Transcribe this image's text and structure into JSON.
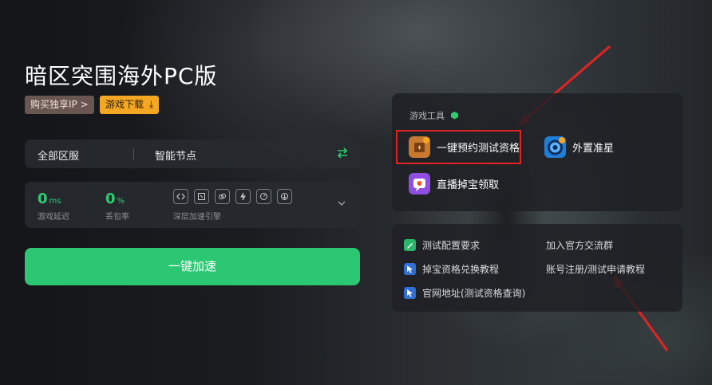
{
  "game": {
    "title": "暗区突围海外PC版",
    "buy_ip_label": "购买独享IP >",
    "download_label": "游戏下载"
  },
  "region": {
    "server_label": "全部区服",
    "node_label": "智能节点"
  },
  "stats": {
    "latency_value": "0",
    "latency_unit": "ms",
    "latency_label": "游戏延迟",
    "loss_value": "0",
    "loss_unit": "%",
    "loss_label": "丢包率",
    "engine_label": "深层加速引擎"
  },
  "accelerate_label": "一键加速",
  "tools": {
    "title": "游戏工具",
    "items": [
      {
        "label": "一键预约测试资格",
        "icon": "reserve-icon",
        "color": "#c9782f"
      },
      {
        "label": "外置准星",
        "icon": "crosshair-icon",
        "color": "#1f7fd8"
      },
      {
        "label": "直播掉宝领取",
        "icon": "live-drop-icon",
        "color": "#8e4fe0"
      }
    ]
  },
  "links": {
    "items": [
      {
        "label": "测试配置要求",
        "icon": "pencil-icon",
        "color": "#2bb66a"
      },
      {
        "label": "加入官方交流群",
        "icon": "",
        "color": ""
      },
      {
        "label": "掉宝资格兑换教程",
        "icon": "cursor-icon",
        "color": "#2f6fd6"
      },
      {
        "label": "账号注册/测试申请教程",
        "icon": "",
        "color": ""
      },
      {
        "label": "官网地址(测试资格查询)",
        "icon": "cursor-icon",
        "color": "#2f6fd6"
      }
    ]
  },
  "colors": {
    "accent_green": "#2bc772",
    "highlight_red": "#e02424",
    "download_orange": "#f5a623"
  }
}
